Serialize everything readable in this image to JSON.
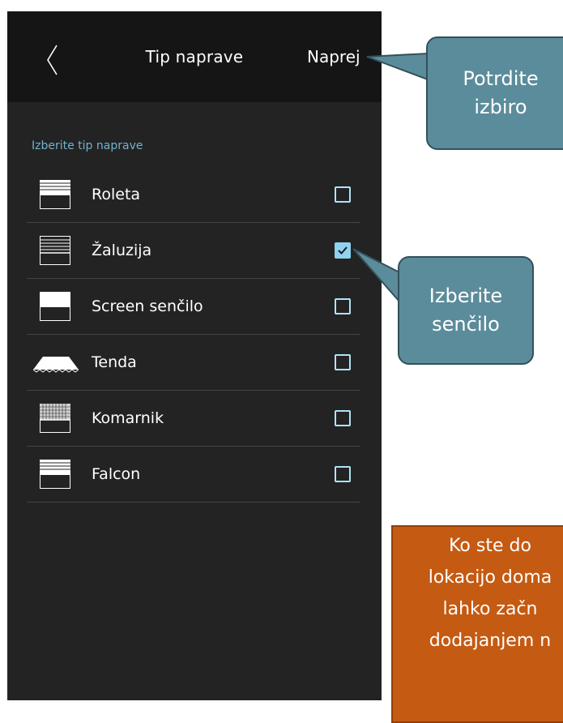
{
  "header": {
    "title": "Tip naprave",
    "next_label": "Naprej",
    "back_icon": "chevron-left-icon"
  },
  "section_label": "Izberite tip naprave",
  "device_types": [
    {
      "label": "Roleta",
      "icon": "roller-shutter-icon",
      "checked": false
    },
    {
      "label": "Žaluzija",
      "icon": "venetian-blind-icon",
      "checked": true
    },
    {
      "label": "Screen senčilo",
      "icon": "screen-shade-icon",
      "checked": false
    },
    {
      "label": "Tenda",
      "icon": "awning-icon",
      "checked": false
    },
    {
      "label": "Komarnik",
      "icon": "insect-screen-icon",
      "checked": false
    },
    {
      "label": "Falcon",
      "icon": "falcon-shade-icon",
      "checked": false
    }
  ],
  "callouts": {
    "confirm": {
      "line1": "Potrdite",
      "line2": "izbiro"
    },
    "select": {
      "line1": "Izberite",
      "line2": "senčilo"
    }
  },
  "info_box": {
    "lines": [
      "Ko ste do",
      "lokacijo doma",
      "lahko začn",
      "dodajanjem n"
    ]
  },
  "colors": {
    "app_background": "#232323",
    "header_background": "#151515",
    "accent": "#6fb3cf",
    "checkbox_checked": "#8fd3f0",
    "callout": "#5b8c9b",
    "info_box": "#c55a12"
  }
}
